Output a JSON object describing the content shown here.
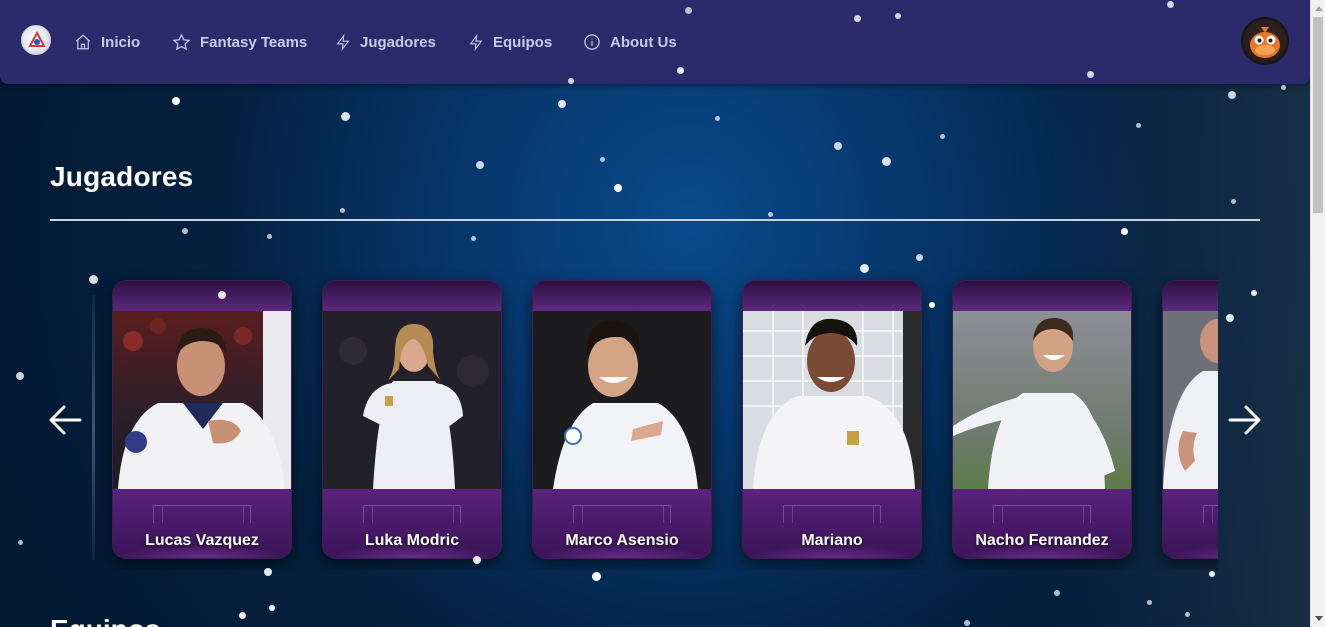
{
  "navbar": {
    "items": [
      {
        "label": "Inicio",
        "icon": "home-icon"
      },
      {
        "label": "Fantasy Teams",
        "icon": "star-icon"
      },
      {
        "label": "Jugadores",
        "icon": "bolt-icon"
      },
      {
        "label": "Equipos",
        "icon": "bolt-icon"
      },
      {
        "label": "About Us",
        "icon": "info-icon"
      }
    ]
  },
  "players_section": {
    "title": "Jugadores"
  },
  "players": [
    {
      "name": "Lucas Vazquez"
    },
    {
      "name": "Luka Modric"
    },
    {
      "name": "Marco Asensio"
    },
    {
      "name": "Mariano"
    },
    {
      "name": "Nacho Fernandez"
    },
    {
      "name": ""
    }
  ],
  "next_section": {
    "title": "Equipos"
  },
  "colors": {
    "navbar": "#2b2b6b",
    "card_purple": "#5b237e",
    "background": "#063467"
  }
}
